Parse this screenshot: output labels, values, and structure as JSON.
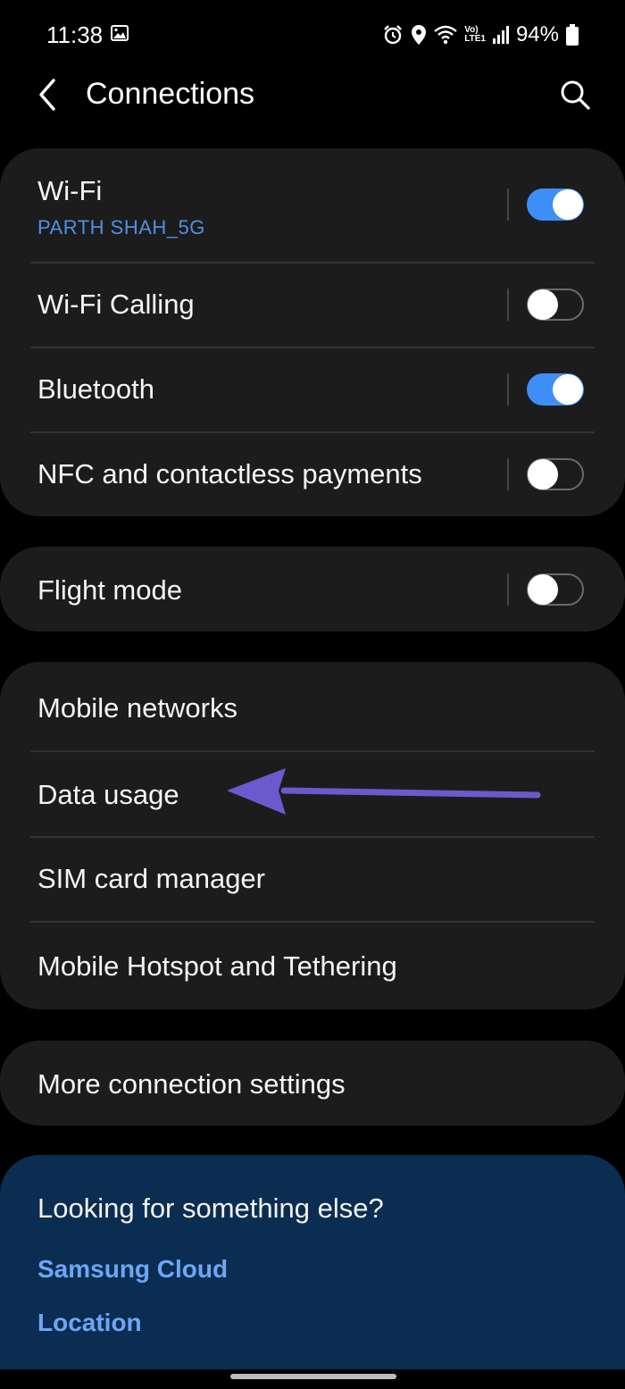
{
  "status_bar": {
    "time": "11:38",
    "volte_label_top": "Vo)",
    "volte_label_bottom": "LTE1",
    "battery": "94%"
  },
  "header": {
    "title": "Connections",
    "back_icon": "chevron-left-icon",
    "search_icon": "search-icon"
  },
  "connectivity": {
    "wifi": {
      "label": "Wi-Fi",
      "network": "PARTH SHAH_5G",
      "enabled": true
    },
    "wifi_calling": {
      "label": "Wi-Fi Calling",
      "enabled": false
    },
    "bluetooth": {
      "label": "Bluetooth",
      "enabled": true
    },
    "nfc": {
      "label": "NFC and contactless payments",
      "enabled": false
    }
  },
  "flight_mode": {
    "label": "Flight mode",
    "enabled": false
  },
  "networks": {
    "items": [
      {
        "label": "Mobile networks"
      },
      {
        "label": "Data usage"
      },
      {
        "label": "SIM card manager"
      },
      {
        "label": "Mobile Hotspot and Tethering"
      }
    ]
  },
  "more_settings": {
    "label": "More connection settings"
  },
  "suggestions": {
    "title": "Looking for something else?",
    "links": [
      "Samsung Cloud",
      "Location"
    ]
  },
  "colors": {
    "accent": "#3e8ef7",
    "link": "#6ea6f5",
    "annotation_arrow": "#6a5acd",
    "card": "#1c1c1c",
    "suggestion_panel": "#0b2d52"
  }
}
